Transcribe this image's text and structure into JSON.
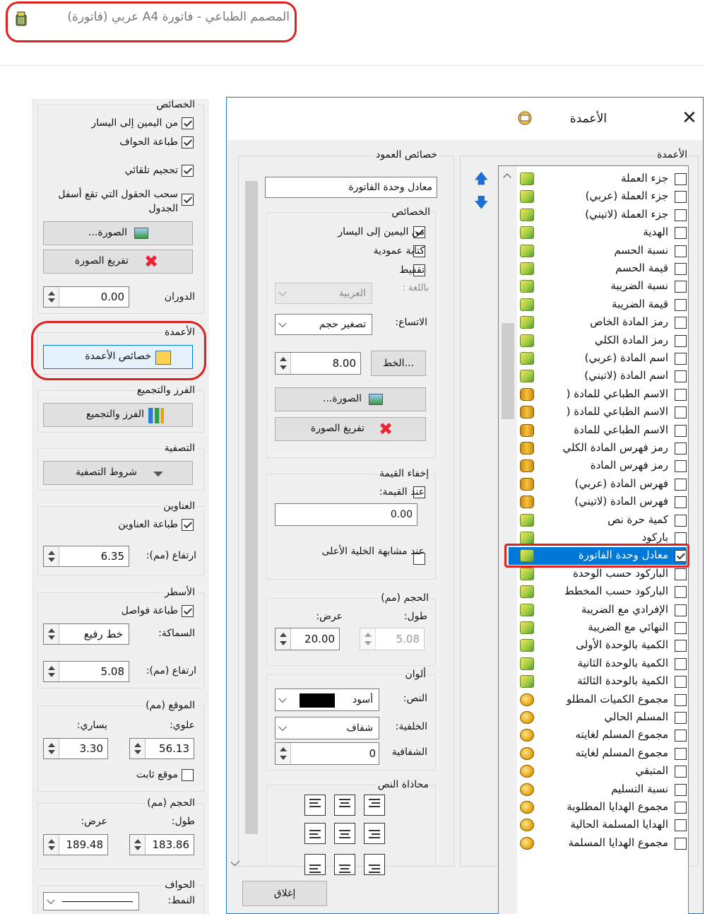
{
  "window": {
    "title": "المصمم الطباعي - فاتورة A4 عربي (فاتورة)"
  },
  "left_panel": {
    "props_group": "الخصائص",
    "rtl_label": "من اليمين إلى اليسار",
    "print_borders_label": "طباعة الحواف",
    "auto_size_label": "تحجيم تلقائي",
    "pull_fields_label": "سحب الحقول التي تقع أسفل الجدول",
    "image_button": "الصورة...",
    "clear_image_button": "تفريغ الصورة",
    "rotation_label": "الدوران",
    "rotation_value": "0.00",
    "columns_group": "الأعمدة",
    "column_props_button": "خصائص الأعمدة",
    "sort_group": "الفرز والتجميع",
    "sort_button": "الفرز والتجميع",
    "filter_group": "التصفية",
    "filter_button": "شروط التصفية",
    "titles_group": "العناوين",
    "print_titles_label": "طباعة العناوين",
    "titles_height_label": "ارتفاع (مم):",
    "titles_height_value": "6.35",
    "rows_group": "الأسطر",
    "print_separators_label": "طباعة فواصل",
    "thickness_label": "السماكة:",
    "thickness_value": "خط رفيع",
    "rows_height_label": "ارتفاع (مم):",
    "rows_height_value": "5.08",
    "position_group": "الموقع (مم)",
    "top_label": "علوي:",
    "left_label": "يساري:",
    "top_value": "56.13",
    "left_value": "3.30",
    "fixed_position_label": "موقع ثابت",
    "size_group": "الحجم (مم)",
    "length_label": "طول:",
    "width_label": "عرض:",
    "length_value": "183.86",
    "width_value": "189.48",
    "borders_group": "الحواف",
    "style_label": "النمط:"
  },
  "dialog": {
    "title": "الأعمدة",
    "close_icon": "close-icon",
    "columns_group": "الأعمدة",
    "column_props_group": "خصائص العمود",
    "column_name_value": "معادل وحدة الفاتورة",
    "props_group": "الخصائص",
    "rtl_label": "من اليمين إلى اليسار",
    "vertical_label": "كتابة عمودية",
    "shading_label": "تقفيط",
    "language_label": "باللغة :",
    "language_value": "العربية",
    "overflow_label": "الاتساع:",
    "overflow_value": "تصغير حجم",
    "font_button": "الخط...",
    "font_size_value": "8.00",
    "image_button": "الصورة...",
    "clear_image_button": "تفريغ الصورة",
    "hide_value_group": "إخفاء القيمة",
    "when_value_label": "عند القيمة:",
    "hide_value_value": "0.00",
    "same_cell_label": "عند مشابهة الخلية الأعلى",
    "size_group": "الحجم (مم)",
    "length_label": "طول:",
    "width_label": "عرض:",
    "length_value": "5.08",
    "width_value": "20.00",
    "colors_group": "ألوان",
    "text_color_label": "النص:",
    "text_color_value": "أسود",
    "background_label": "الخلفية:",
    "background_value": "شفاف",
    "opacity_label": "الشفافية",
    "opacity_value": "0",
    "text_align_group": "محاذاة النص",
    "close_button": "إغلاق"
  },
  "columns_list": [
    {
      "label": "جزء العملة",
      "icon": "pencil-icon",
      "checked": false
    },
    {
      "label": "جزء العملة (عربي)",
      "icon": "pencil-icon",
      "checked": false
    },
    {
      "label": "جزء العملة (لاتيني)",
      "icon": "pencil-icon",
      "checked": false
    },
    {
      "label": "الهدية",
      "icon": "pencil-icon",
      "checked": false
    },
    {
      "label": "نسبة الحسم",
      "icon": "pencil-icon",
      "checked": false
    },
    {
      "label": "قيمة الحسم",
      "icon": "pencil-icon",
      "checked": false
    },
    {
      "label": "نسبة الضريبة",
      "icon": "pencil-icon",
      "checked": false
    },
    {
      "label": "قيمة الضريبة",
      "icon": "pencil-icon",
      "checked": false
    },
    {
      "label": "رمز المادة الخاص",
      "icon": "pencil-icon",
      "checked": false
    },
    {
      "label": "رمز المادة الكلي",
      "icon": "pencil-icon",
      "checked": false
    },
    {
      "label": "اسم المادة (عربي)",
      "icon": "pencil-icon",
      "checked": false
    },
    {
      "label": "اسم المادة (لاتيني)",
      "icon": "pencil-icon",
      "checked": false
    },
    {
      "label": "الاسم الطباعي للمادة (",
      "icon": "barrel-icon",
      "checked": false
    },
    {
      "label": "الاسم الطباعي للمادة (",
      "icon": "barrel-icon",
      "checked": false
    },
    {
      "label": "الاسم الطباعي للمادة",
      "icon": "barrel-icon",
      "checked": false
    },
    {
      "label": "رمز فهرس المادة الكلي",
      "icon": "barrel-icon",
      "checked": false
    },
    {
      "label": "رمز فهرس المادة",
      "icon": "barrel-icon",
      "checked": false
    },
    {
      "label": "فهرس المادة (عربي)",
      "icon": "barrel-icon",
      "checked": false
    },
    {
      "label": "فهرس المادة (لاتيني)",
      "icon": "barrel-icon",
      "checked": false
    },
    {
      "label": "كمية حرة نص",
      "icon": "pencil-icon",
      "checked": false
    },
    {
      "label": "باركود",
      "icon": "pencil-icon",
      "checked": false
    },
    {
      "label": "معادل وحدة الفاتورة",
      "icon": "pencil-icon",
      "checked": true
    },
    {
      "label": "الباركود حسب الوحدة",
      "icon": "pencil-icon",
      "checked": false
    },
    {
      "label": "الباركود حسب المخطط",
      "icon": "pencil-icon",
      "checked": false
    },
    {
      "label": "الإفرادي مع الضريبة",
      "icon": "pencil-icon",
      "checked": false
    },
    {
      "label": "النهائي مع الضريبة",
      "icon": "pencil-icon",
      "checked": false
    },
    {
      "label": "الكمية بالوحدة الأولى",
      "icon": "pencil-icon",
      "checked": false
    },
    {
      "label": "الكمية بالوحدة الثانية",
      "icon": "pencil-icon",
      "checked": false
    },
    {
      "label": "الكمية بالوحدة الثالثة",
      "icon": "pencil-icon",
      "checked": false
    },
    {
      "label": "مجموع الكميات المطلو",
      "icon": "coin-icon",
      "checked": false
    },
    {
      "label": "المسلم الحالي",
      "icon": "coin-icon",
      "checked": false
    },
    {
      "label": "مجموع المسلم لغايته",
      "icon": "coin-icon",
      "checked": false
    },
    {
      "label": "مجموع المسلم لغايته",
      "icon": "coin-icon",
      "checked": false
    },
    {
      "label": "المتبقي",
      "icon": "coin-icon",
      "checked": false
    },
    {
      "label": "نسبة التسليم",
      "icon": "coin-icon",
      "checked": false
    },
    {
      "label": "مجموع الهدايا المطلوبة",
      "icon": "coin-icon",
      "checked": false
    },
    {
      "label": "الهدايا المسلمة الحالية",
      "icon": "coin-icon",
      "checked": false
    },
    {
      "label": "مجموع الهدايا المسلمة",
      "icon": "coin-icon",
      "checked": false
    }
  ]
}
